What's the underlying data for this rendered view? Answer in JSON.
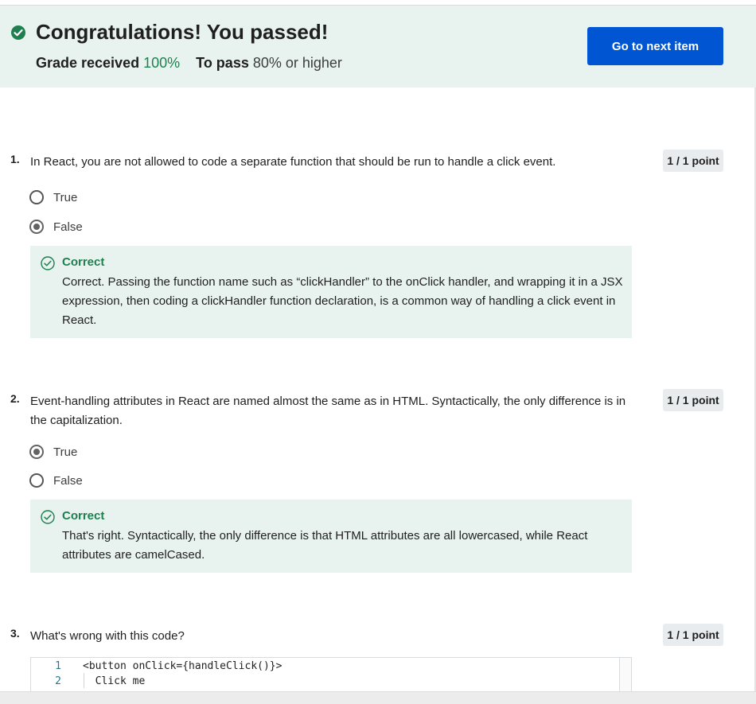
{
  "banner": {
    "title": "Congratulations! You passed!",
    "grade_label": "Grade received",
    "grade_value": "100%",
    "pass_label": "To pass",
    "pass_value": "80% or higher",
    "next_button": "Go to next item",
    "accent_color": "#1e7f4f",
    "button_color": "#0056d2"
  },
  "questions": [
    {
      "number": "1.",
      "text": "In React, you are not allowed to code a separate function that should be run to handle a click event.",
      "points": "1 / 1 point",
      "options": [
        {
          "label": "True",
          "selected": false
        },
        {
          "label": "False",
          "selected": true
        }
      ],
      "feedback": {
        "title": "Correct",
        "text": "Correct. Passing the function name such as “clickHandler” to the onClick handler, and wrapping it in a JSX expression, then coding a clickHandler function declaration, is a common way of handling a click event in React."
      }
    },
    {
      "number": "2.",
      "text": "Event-handling attributes in React are named almost the same as in HTML. Syntactically, the only difference is in the capitalization.",
      "points": "1 / 1 point",
      "options": [
        {
          "label": "True",
          "selected": true
        },
        {
          "label": "False",
          "selected": false
        }
      ],
      "feedback": {
        "title": "Correct",
        "text": "That's right. Syntactically, the only difference is that HTML attributes are all lowercased, while React attributes are camelCased."
      }
    },
    {
      "number": "3.",
      "text": "What's wrong with this code?",
      "points": "1 / 1 point",
      "code": [
        {
          "ln": "1",
          "src": "<button onClick={handleClick()}>"
        },
        {
          "ln": "2",
          "src": "  Click me"
        }
      ]
    }
  ]
}
